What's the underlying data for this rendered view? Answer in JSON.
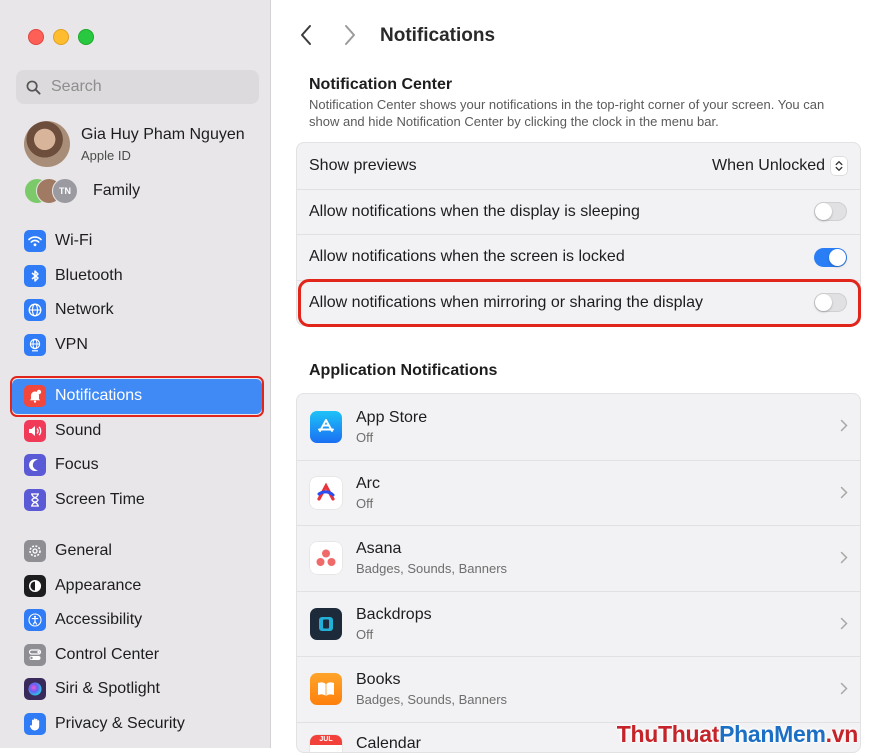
{
  "window": {
    "traffic_lights": [
      "close",
      "minimize",
      "zoom"
    ]
  },
  "sidebar": {
    "search_placeholder": "Search",
    "profile": {
      "name": "Gia Huy Pham Nguyen",
      "sub": "Apple ID"
    },
    "family": {
      "label": "Family",
      "avatar_initials": "TN"
    },
    "groups": [
      [
        {
          "label": "Wi-Fi",
          "icon": "wifi-icon",
          "color": "#2f7cf6"
        },
        {
          "label": "Bluetooth",
          "icon": "bluetooth-icon",
          "color": "#2f7cf6"
        },
        {
          "label": "Network",
          "icon": "globe-icon",
          "color": "#2f7cf6"
        },
        {
          "label": "VPN",
          "icon": "vpn-globe-icon",
          "color": "#2f7cf6"
        }
      ],
      [
        {
          "label": "Notifications",
          "icon": "bell-icon",
          "color": "#f1473d",
          "active": true
        },
        {
          "label": "Sound",
          "icon": "speaker-icon",
          "color": "#f13a58"
        },
        {
          "label": "Focus",
          "icon": "moon-icon",
          "color": "#5b5ad6"
        },
        {
          "label": "Screen Time",
          "icon": "hourglass-icon",
          "color": "#5b5ad6"
        }
      ],
      [
        {
          "label": "General",
          "icon": "gear-icon",
          "color": "#8e8e93"
        },
        {
          "label": "Appearance",
          "icon": "appearance-icon",
          "color": "#1d1d1f"
        },
        {
          "label": "Accessibility",
          "icon": "accessibility-icon",
          "color": "#2f7cf6"
        },
        {
          "label": "Control Center",
          "icon": "control-center-icon",
          "color": "#8e8e93"
        },
        {
          "label": "Siri & Spotlight",
          "icon": "siri-icon",
          "color": "#3a2a5c"
        },
        {
          "label": "Privacy & Security",
          "icon": "hand-icon",
          "color": "#2f7cf6"
        }
      ]
    ]
  },
  "main": {
    "title": "Notifications",
    "notification_center": {
      "title": "Notification Center",
      "description": "Notification Center shows your notifications in the top-right corner of your screen. You can show and hide Notification Center by clicking the clock in the menu bar.",
      "rows": [
        {
          "label": "Show previews",
          "control": "popup",
          "value": "When Unlocked"
        },
        {
          "label": "Allow notifications when the display is sleeping",
          "control": "toggle",
          "on": false
        },
        {
          "label": "Allow notifications when the screen is locked",
          "control": "toggle",
          "on": true
        },
        {
          "label": "Allow notifications when mirroring or sharing the display",
          "control": "toggle",
          "on": false,
          "highlighted": true
        }
      ]
    },
    "app_notifications": {
      "title": "Application Notifications",
      "apps": [
        {
          "name": "App Store",
          "sub": "Off",
          "icon": "app-store-icon"
        },
        {
          "name": "Arc",
          "sub": "Off",
          "icon": "arc-icon"
        },
        {
          "name": "Asana",
          "sub": "Badges, Sounds, Banners",
          "icon": "asana-icon"
        },
        {
          "name": "Backdrops",
          "sub": "Off",
          "icon": "backdrops-icon"
        },
        {
          "name": "Books",
          "sub": "Badges, Sounds, Banners",
          "icon": "books-icon"
        },
        {
          "name": "Calendar",
          "sub": "",
          "icon": "calendar-icon",
          "icon_text": "JUL"
        }
      ]
    }
  },
  "watermark": {
    "part1": "ThuThuat",
    "part2": "PhanMem",
    "part3": ".vn"
  }
}
